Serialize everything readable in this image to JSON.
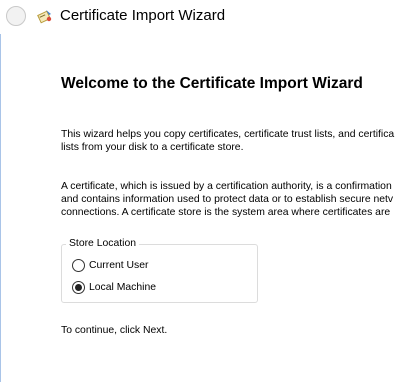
{
  "window": {
    "title": "Certificate Import Wizard",
    "icon": "certificate-wizard-icon"
  },
  "titlebar": {
    "back_icon": "back-arrow-icon"
  },
  "content": {
    "heading": "Welcome to the Certificate Import Wizard",
    "paragraph1": [
      "This wizard helps you copy certificates, certificate trust lists, and certifica",
      "lists from your disk to a certificate store."
    ],
    "paragraph2": [
      "A certificate, which is issued by a certification authority, is a confirmation",
      "and contains information used to protect data or to establish secure netv",
      "connections. A certificate store is the system area where certificates are"
    ],
    "store_location": {
      "label": "Store Location",
      "options": [
        {
          "label": "Current User",
          "selected": false
        },
        {
          "label": "Local Machine",
          "selected": true
        }
      ]
    },
    "continue_text": "To continue, click Next."
  },
  "colors": {
    "accent": "#a9c4e8",
    "groupbox_border": "#dcdcdc"
  }
}
